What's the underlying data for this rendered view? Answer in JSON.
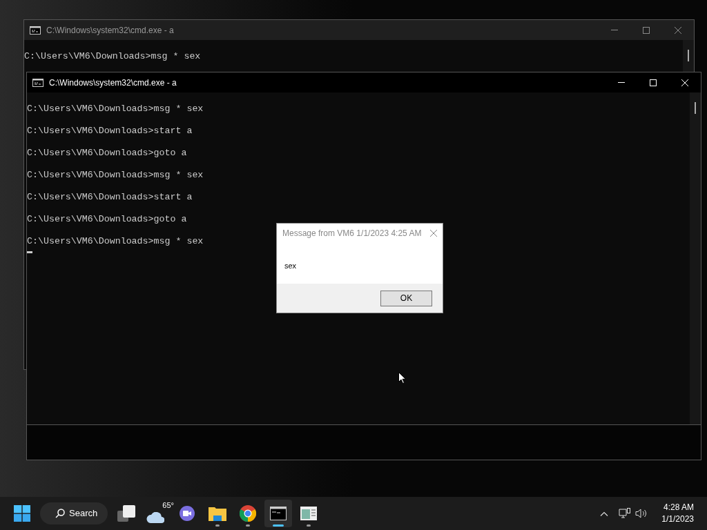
{
  "windows": [
    {
      "title": "C:\\Windows\\system32\\cmd.exe - a",
      "active": false,
      "lines": [
        "C:\\Users\\VM6\\Downloads>msg * sex"
      ],
      "cursor": false
    },
    {
      "title": "C:\\Windows\\system32\\cmd.exe - a",
      "active": true,
      "lines": [
        "C:\\Users\\VM6\\Downloads>msg * sex",
        "C:\\Users\\VM6\\Downloads>start a",
        "C:\\Users\\VM6\\Downloads>goto a",
        "C:\\Users\\VM6\\Downloads>msg * sex",
        "C:\\Users\\VM6\\Downloads>start a",
        "C:\\Users\\VM6\\Downloads>goto a",
        "C:\\Users\\VM6\\Downloads>msg * sex"
      ],
      "cursor": true
    }
  ],
  "dialog": {
    "title": "Message from VM6 1/1/2023 4:25 AM",
    "message": "sex",
    "button": "OK"
  },
  "taskbar": {
    "search": "Search",
    "apps": [
      {
        "kind": "taskview",
        "running": false,
        "selected": false
      },
      {
        "kind": "weather",
        "label": "65°",
        "running": false,
        "selected": false
      },
      {
        "kind": "chat",
        "running": false,
        "selected": false
      },
      {
        "kind": "explorer",
        "running": true,
        "selected": false
      },
      {
        "kind": "chrome",
        "running": true,
        "selected": false
      },
      {
        "kind": "terminal",
        "running": true,
        "selected": true
      },
      {
        "kind": "window",
        "running": true,
        "selected": false
      }
    ],
    "time": "4:28 AM",
    "date": "1/1/2023"
  }
}
